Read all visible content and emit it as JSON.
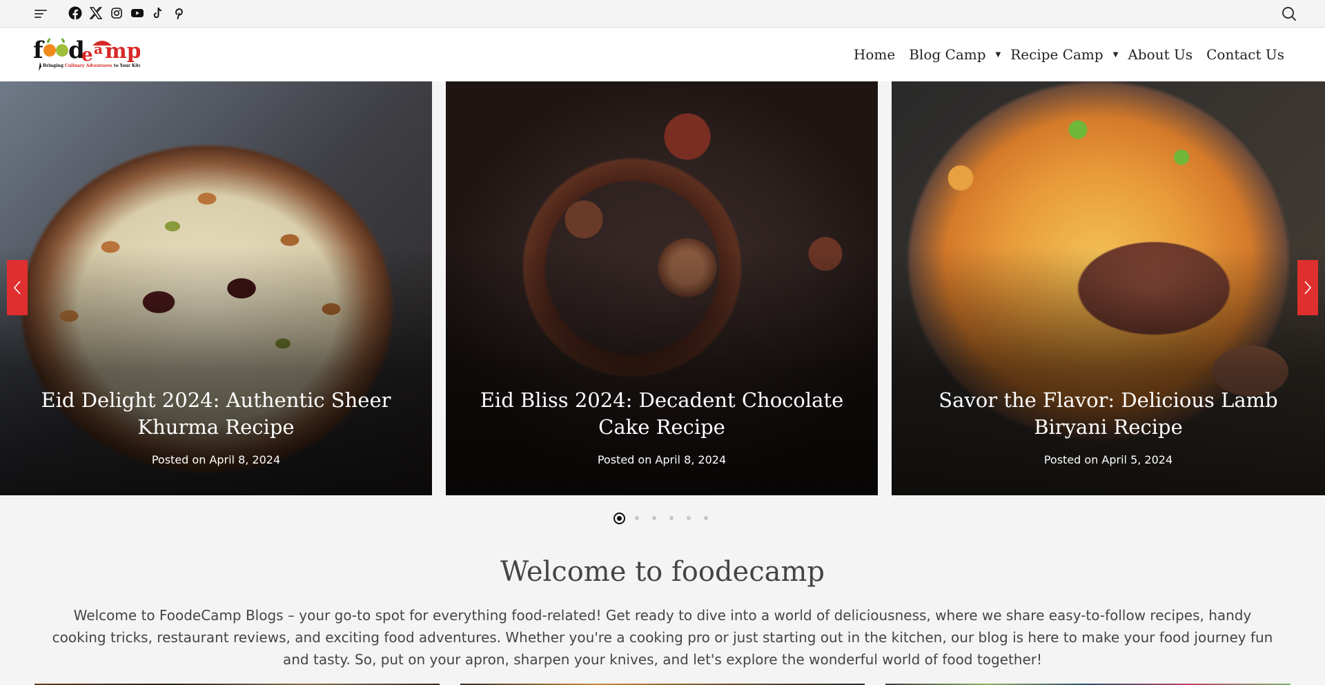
{
  "topbar": {
    "menu_icon": "hamburger-menu-icon",
    "social": [
      {
        "name": "facebook",
        "icon": "facebook-icon"
      },
      {
        "name": "x",
        "icon": "x-twitter-icon"
      },
      {
        "name": "instagram",
        "icon": "instagram-icon"
      },
      {
        "name": "youtube",
        "icon": "youtube-icon"
      },
      {
        "name": "tiktok",
        "icon": "tiktok-icon"
      },
      {
        "name": "pinterest",
        "icon": "pinterest-icon"
      }
    ],
    "search_icon": "search-icon"
  },
  "header": {
    "logo": {
      "text_part1": "food",
      "text_part2": "e",
      "text_part3": "a",
      "text_part4": "mp",
      "tagline_1": "Bringing ",
      "tagline_2": "Culinary Adventures",
      "tagline_3": " to Your Kitchen"
    },
    "nav": [
      {
        "label": "Home",
        "has_dropdown": false
      },
      {
        "label": "Blog Camp",
        "has_dropdown": true
      },
      {
        "label": "Recipe Camp",
        "has_dropdown": true
      },
      {
        "label": "About Us",
        "has_dropdown": false
      },
      {
        "label": "Contact Us",
        "has_dropdown": false
      }
    ],
    "caret": "▼"
  },
  "slider": {
    "slides": [
      {
        "title": "Eid Delight 2024: Authentic Sheer Khurma Recipe",
        "date": "Posted on April 8, 2024"
      },
      {
        "title": "Eid Bliss 2024: Decadent Chocolate Cake Recipe",
        "date": "Posted on April 8, 2024"
      },
      {
        "title": "Savor the Flavor: Delicious Lamb Biryani Recipe",
        "date": "Posted on April 5, 2024"
      }
    ],
    "prev_icon": "chevron-left-icon",
    "next_icon": "chevron-right-icon",
    "accent_color": "#e02f2f",
    "page_count": 6,
    "active_page": 1
  },
  "welcome": {
    "title": "Welcome to foodecamp",
    "text": "Welcome to FoodeCamp Blogs – your go-to spot for everything food-related! Get ready to dive into a world of deliciousness, where we share easy-to-follow recipes, handy cooking tricks, restaurant reviews, and exciting food adventures. Whether you're a cooking pro or just starting out in the kitchen, our blog is here to make your food journey fun and tasty. So, put on your apron, sharpen your knives, and let's explore the wonderful world of food together!"
  }
}
